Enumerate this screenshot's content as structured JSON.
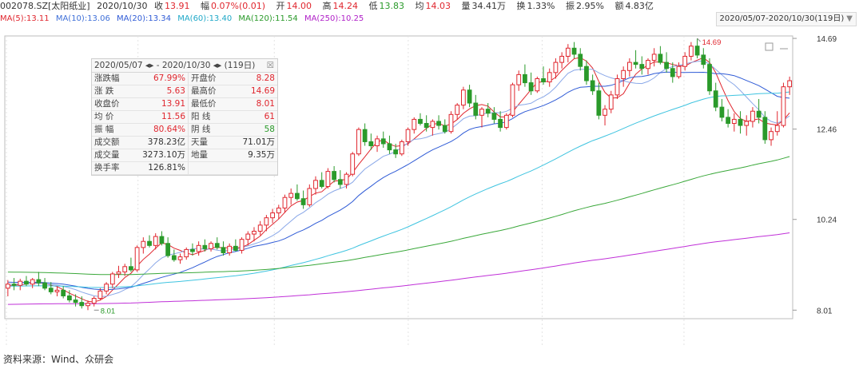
{
  "header": {
    "code": "002078.SZ[太阳纸业]",
    "date": "2020/10/30",
    "close_label": "收",
    "close": "13.91",
    "pct_label": "幅",
    "pct": "0.07%(0.01)",
    "open_label": "开",
    "open": "14.00",
    "high_label": "高",
    "high": "14.24",
    "low_label": "低",
    "low": "13.83",
    "last_label": "均",
    "last": "14.03",
    "vol_label": "量",
    "vol": "34.41万",
    "turn_label": "换",
    "turn": "1.33%",
    "amp_label": "振",
    "amp": "2.95%",
    "amt_label": "额",
    "amt": "4.83亿"
  },
  "range_select": {
    "value": "2020/05/07-2020/10/30(119日)"
  },
  "ma_legend": [
    {
      "label": "MA(5):13.11",
      "color": "#e0262e"
    },
    {
      "label": "MA(10):13.06",
      "color": "#3e6fd8"
    },
    {
      "label": "MA(20):13.34",
      "color": "#2f5bd6"
    },
    {
      "label": "MA(60):13.40",
      "color": "#3fc4e0"
    },
    {
      "label": "MA(120):11.54",
      "color": "#3aa83a"
    },
    {
      "label": "MA(250):10.25",
      "color": "#c030d8"
    }
  ],
  "stats": {
    "title": "2020/05/07 ◂▸ - 2020/10/30 ◂▸ (119日)",
    "close_x": "☒",
    "rows": [
      {
        "k1": "涨跌幅",
        "v1": "67.99%",
        "c1": "red",
        "k2": "开盘价",
        "v2": "8.28",
        "c2": "red"
      },
      {
        "k1": "涨  跌",
        "v1": "5.63",
        "c1": "red",
        "k2": "最高价",
        "v2": "14.69",
        "c2": "red"
      },
      {
        "k1": "收盘价",
        "v1": "13.91",
        "c1": "red",
        "k2": "最低价",
        "v2": "8.01",
        "c2": "red"
      },
      {
        "k1": "均  价",
        "v1": "11.56",
        "c1": "red",
        "k2": "阳  线",
        "v2": "61",
        "c2": "red"
      },
      {
        "k1": "振  幅",
        "v1": "80.64%",
        "c1": "red",
        "k2": "阴  线",
        "v2": "58",
        "c2": "green"
      },
      {
        "k1": "成交额",
        "v1": "378.23亿",
        "c1": "dark",
        "k2": "天量",
        "v2": "71.01万",
        "c2": "dark"
      },
      {
        "k1": "成交量",
        "v1": "3273.10万",
        "c1": "dark",
        "k2": "地量",
        "v2": "9.35万",
        "c2": "dark"
      },
      {
        "k1": "换手率",
        "v1": "126.81%",
        "c1": "dark",
        "k2": "",
        "v2": "",
        "c2": "dark"
      }
    ]
  },
  "source": "资料来源：Wind、众研会",
  "chart_data": {
    "type": "candlestick",
    "ylim": [
      7.8,
      14.75
    ],
    "yticks": [
      14.69,
      12.46,
      10.24,
      8.01
    ],
    "ytick_labels": [
      "14.69",
      "12.46",
      "10.24",
      "8.01"
    ],
    "annotations": [
      {
        "label": "14.69",
        "x_index": 112,
        "y": 14.69,
        "color": "#e0262e"
      },
      {
        "label": "8.01",
        "x_index": 14,
        "y": 8.01,
        "color": "#2a9a2a"
      }
    ],
    "colors": {
      "up": "#e0262e",
      "down": "#2a9a2a",
      "grid": "#e3e3e3",
      "frame": "#bdbdbd"
    },
    "candles": [
      [
        8.55,
        8.75,
        8.35,
        8.65
      ],
      [
        8.65,
        8.8,
        8.5,
        8.62
      ],
      [
        8.62,
        8.78,
        8.5,
        8.72
      ],
      [
        8.72,
        8.85,
        8.6,
        8.65
      ],
      [
        8.65,
        8.8,
        8.55,
        8.76
      ],
      [
        8.76,
        8.95,
        8.6,
        8.68
      ],
      [
        8.68,
        8.8,
        8.5,
        8.55
      ],
      [
        8.55,
        8.7,
        8.4,
        8.46
      ],
      [
        8.46,
        8.6,
        8.35,
        8.5
      ],
      [
        8.5,
        8.6,
        8.3,
        8.36
      ],
      [
        8.36,
        8.5,
        8.2,
        8.26
      ],
      [
        8.26,
        8.4,
        8.1,
        8.2
      ],
      [
        8.2,
        8.35,
        8.05,
        8.12
      ],
      [
        8.12,
        8.25,
        8.01,
        8.18
      ],
      [
        8.18,
        8.35,
        8.1,
        8.3
      ],
      [
        8.3,
        8.55,
        8.25,
        8.48
      ],
      [
        8.48,
        8.7,
        8.4,
        8.65
      ],
      [
        8.65,
        8.95,
        8.55,
        8.9
      ],
      [
        8.9,
        9.1,
        8.8,
        8.95
      ],
      [
        8.95,
        9.15,
        8.85,
        9.08
      ],
      [
        9.08,
        9.3,
        8.95,
        9.0
      ],
      [
        9.0,
        9.6,
        8.95,
        9.55
      ],
      [
        9.55,
        9.8,
        9.4,
        9.7
      ],
      [
        9.7,
        9.85,
        9.55,
        9.6
      ],
      [
        9.6,
        9.9,
        9.5,
        9.82
      ],
      [
        9.82,
        9.95,
        9.6,
        9.65
      ],
      [
        9.65,
        9.8,
        9.3,
        9.35
      ],
      [
        9.35,
        9.5,
        9.2,
        9.25
      ],
      [
        9.25,
        9.4,
        9.15,
        9.32
      ],
      [
        9.32,
        9.55,
        9.25,
        9.5
      ],
      [
        9.5,
        9.65,
        9.35,
        9.45
      ],
      [
        9.45,
        9.7,
        9.35,
        9.6
      ],
      [
        9.6,
        9.75,
        9.45,
        9.52
      ],
      [
        9.52,
        9.7,
        9.45,
        9.65
      ],
      [
        9.65,
        9.8,
        9.5,
        9.55
      ],
      [
        9.55,
        9.7,
        9.35,
        9.42
      ],
      [
        9.42,
        9.65,
        9.35,
        9.58
      ],
      [
        9.58,
        9.75,
        9.45,
        9.48
      ],
      [
        9.48,
        9.8,
        9.4,
        9.75
      ],
      [
        9.75,
        9.95,
        9.6,
        9.88
      ],
      [
        9.88,
        10.05,
        9.7,
        9.95
      ],
      [
        9.95,
        10.2,
        9.85,
        10.1
      ],
      [
        10.1,
        10.35,
        9.95,
        10.28
      ],
      [
        10.28,
        10.5,
        10.15,
        10.4
      ],
      [
        10.4,
        10.6,
        10.25,
        10.52
      ],
      [
        10.52,
        10.85,
        10.4,
        10.78
      ],
      [
        10.78,
        11.0,
        10.6,
        10.88
      ],
      [
        10.88,
        11.1,
        10.7,
        10.75
      ],
      [
        10.75,
        10.95,
        10.5,
        10.6
      ],
      [
        10.6,
        11.1,
        10.55,
        11.0
      ],
      [
        11.0,
        11.3,
        10.85,
        11.2
      ],
      [
        11.2,
        11.4,
        11.0,
        11.05
      ],
      [
        11.05,
        11.5,
        11.0,
        11.42
      ],
      [
        11.42,
        11.55,
        11.15,
        11.22
      ],
      [
        11.22,
        11.45,
        11.0,
        11.1
      ],
      [
        11.1,
        11.4,
        11.0,
        11.35
      ],
      [
        11.35,
        11.9,
        11.3,
        11.85
      ],
      [
        11.85,
        12.5,
        11.8,
        12.45
      ],
      [
        12.45,
        12.6,
        12.05,
        12.15
      ],
      [
        12.15,
        12.35,
        11.95,
        12.05
      ],
      [
        12.05,
        12.3,
        11.9,
        12.22
      ],
      [
        12.22,
        12.4,
        12.0,
        12.1
      ],
      [
        12.1,
        12.3,
        11.85,
        11.95
      ],
      [
        11.95,
        12.1,
        11.75,
        11.85
      ],
      [
        11.85,
        12.2,
        11.8,
        12.15
      ],
      [
        12.15,
        12.5,
        12.05,
        12.45
      ],
      [
        12.45,
        12.75,
        12.35,
        12.7
      ],
      [
        12.7,
        12.85,
        12.55,
        12.6
      ],
      [
        12.6,
        12.8,
        12.4,
        12.5
      ],
      [
        12.5,
        12.7,
        12.3,
        12.65
      ],
      [
        12.65,
        12.8,
        12.45,
        12.55
      ],
      [
        12.55,
        12.7,
        12.35,
        12.4
      ],
      [
        12.4,
        12.9,
        12.35,
        12.82
      ],
      [
        12.82,
        13.1,
        12.7,
        13.05
      ],
      [
        13.05,
        13.5,
        12.95,
        13.42
      ],
      [
        13.42,
        13.55,
        13.0,
        13.1
      ],
      [
        13.1,
        13.3,
        12.7,
        12.8
      ],
      [
        12.8,
        13.0,
        12.5,
        12.95
      ],
      [
        12.95,
        13.1,
        12.75,
        12.85
      ],
      [
        12.85,
        13.0,
        12.6,
        12.7
      ],
      [
        12.7,
        12.9,
        12.4,
        12.5
      ],
      [
        12.5,
        12.85,
        12.45,
        12.8
      ],
      [
        12.8,
        13.6,
        12.75,
        13.55
      ],
      [
        13.55,
        13.9,
        13.4,
        13.8
      ],
      [
        13.8,
        14.05,
        13.5,
        13.6
      ],
      [
        13.6,
        13.85,
        13.3,
        13.4
      ],
      [
        13.4,
        13.75,
        13.35,
        13.7
      ],
      [
        13.7,
        14.0,
        13.55,
        13.62
      ],
      [
        13.62,
        13.95,
        13.5,
        13.85
      ],
      [
        13.85,
        14.2,
        13.7,
        14.1
      ],
      [
        14.1,
        14.35,
        13.95,
        14.25
      ],
      [
        14.25,
        14.55,
        14.1,
        14.45
      ],
      [
        14.45,
        14.6,
        14.2,
        14.3
      ],
      [
        14.3,
        14.45,
        13.9,
        14.0
      ],
      [
        14.0,
        14.15,
        13.55,
        13.65
      ],
      [
        13.65,
        13.8,
        13.3,
        13.4
      ],
      [
        13.4,
        13.6,
        12.7,
        12.8
      ],
      [
        12.8,
        13.05,
        12.55,
        12.95
      ],
      [
        12.95,
        13.4,
        12.85,
        13.3
      ],
      [
        13.3,
        13.8,
        13.2,
        13.7
      ],
      [
        13.7,
        14.0,
        13.5,
        13.9
      ],
      [
        13.9,
        14.2,
        13.75,
        14.1
      ],
      [
        14.1,
        14.4,
        13.95,
        14.05
      ],
      [
        14.05,
        14.25,
        13.8,
        13.95
      ],
      [
        13.95,
        14.2,
        13.8,
        14.15
      ],
      [
        14.15,
        14.45,
        14.0,
        14.3
      ],
      [
        14.3,
        14.5,
        14.05,
        14.1
      ],
      [
        14.1,
        14.35,
        13.85,
        13.95
      ],
      [
        13.95,
        14.1,
        13.6,
        13.75
      ],
      [
        13.75,
        14.1,
        13.7,
        14.0
      ],
      [
        14.0,
        14.35,
        13.9,
        14.25
      ],
      [
        14.25,
        14.6,
        14.15,
        14.5
      ],
      [
        14.5,
        14.69,
        14.2,
        14.28
      ],
      [
        14.28,
        14.45,
        13.95,
        14.05
      ],
      [
        14.05,
        14.2,
        13.3,
        13.4
      ],
      [
        13.4,
        13.6,
        12.9,
        13.0
      ],
      [
        13.0,
        13.2,
        12.65,
        12.75
      ],
      [
        12.75,
        12.95,
        12.5,
        12.6
      ],
      [
        12.6,
        12.85,
        12.4,
        12.7
      ],
      [
        12.7,
        12.9,
        12.35,
        12.55
      ],
      [
        12.55,
        12.8,
        12.3,
        12.65
      ],
      [
        12.65,
        13.0,
        12.5,
        12.9
      ],
      [
        12.9,
        13.2,
        12.6,
        12.75
      ],
      [
        12.75,
        12.9,
        12.1,
        12.2
      ],
      [
        12.2,
        12.5,
        12.05,
        12.4
      ],
      [
        12.4,
        12.9,
        12.3,
        12.55
      ],
      [
        12.55,
        13.6,
        12.5,
        13.5
      ],
      [
        13.5,
        13.75,
        13.3,
        13.65
      ]
    ]
  }
}
